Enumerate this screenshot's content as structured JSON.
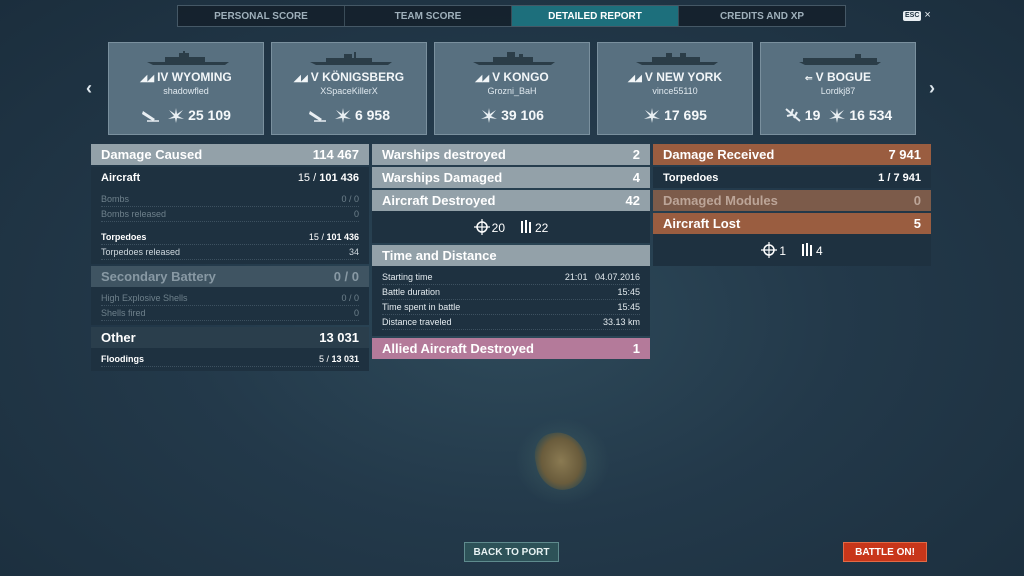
{
  "tabs": [
    {
      "label": "PERSONAL SCORE",
      "active": false
    },
    {
      "label": "TEAM SCORE",
      "active": false
    },
    {
      "label": "DETAILED REPORT",
      "active": true
    },
    {
      "label": "CREDITS AND XP",
      "active": false
    }
  ],
  "esc": {
    "key": "ESC",
    "close": "×"
  },
  "nav": {
    "prev": "‹",
    "next": "›"
  },
  "ships": [
    {
      "tier": "IV",
      "name": "WYOMING",
      "player": "shadowfled",
      "class_icon": "battleship-icon",
      "stat1": null,
      "stat2": "25 109"
    },
    {
      "tier": "V",
      "name": "KÖNIGSBERG",
      "player": "XSpaceKillerX",
      "class_icon": "cruiser-icon",
      "stat1": null,
      "stat2": "6 958"
    },
    {
      "tier": "V",
      "name": "KONGO",
      "player": "Grozni_BaH",
      "class_icon": "battleship-icon",
      "stat1": null,
      "stat2": "39 106"
    },
    {
      "tier": "V",
      "name": "NEW YORK",
      "player": "vince55110",
      "class_icon": "battleship-icon",
      "stat1": null,
      "stat2": "17 695"
    },
    {
      "tier": "V",
      "name": "BOGUE",
      "player": "Lordkj87",
      "class_icon": "carrier-icon",
      "stat1": "19",
      "stat2": "16 534"
    }
  ],
  "left": {
    "damage_caused": {
      "label": "Damage Caused",
      "value": "114 467"
    },
    "aircraft": {
      "label": "Aircraft",
      "value_a": "15",
      "value_b": "101 436"
    },
    "bombs": {
      "label": "Bombs",
      "value": "0 / 0"
    },
    "bombs_released": {
      "label": "Bombs released",
      "value": "0"
    },
    "torpedoes": {
      "label": "Torpedoes",
      "value_a": "15",
      "value_b": "101 436"
    },
    "torpedoes_released": {
      "label": "Torpedoes released",
      "value": "34"
    },
    "secondary": {
      "label": "Secondary Battery",
      "value": "0 / 0"
    },
    "he_shells": {
      "label": "High Explosive Shells",
      "value": "0 / 0"
    },
    "shells_fired": {
      "label": "Shells fired",
      "value": "0"
    },
    "other": {
      "label": "Other",
      "value": "13 031"
    },
    "floodings": {
      "label": "Floodings",
      "value_a": "5",
      "value_b": "13 031"
    }
  },
  "middle": {
    "warships_destroyed": {
      "label": "Warships destroyed",
      "value": "2"
    },
    "warships_damaged": {
      "label": "Warships Damaged",
      "value": "4"
    },
    "aircraft_destroyed": {
      "label": "Aircraft Destroyed",
      "value": "42"
    },
    "icons": {
      "shot_down": "20",
      "squadrons": "22"
    },
    "time_title": "Time and Distance",
    "starting_time": {
      "label": "Starting time",
      "value": "21:01   04.07.2016"
    },
    "battle_duration": {
      "label": "Battle duration",
      "value": "15:45"
    },
    "time_in_battle": {
      "label": "Time spent in battle",
      "value": "15:45"
    },
    "distance": {
      "label": "Distance traveled",
      "value": "33.13 km"
    },
    "allied_aircraft": {
      "label": "Allied Aircraft Destroyed",
      "value": "1"
    }
  },
  "right": {
    "damage_received": {
      "label": "Damage Received",
      "value": "7 941"
    },
    "torpedoes": {
      "label": "Torpedoes",
      "value": "1 / 7 941"
    },
    "damaged_modules": {
      "label": "Damaged Modules",
      "value": "0"
    },
    "aircraft_lost": {
      "label": "Aircraft Lost",
      "value": "5"
    },
    "icons": {
      "shot_down": "1",
      "squadrons": "4"
    }
  },
  "buttons": {
    "back": "BACK TO PORT",
    "battle": "BATTLE ON!"
  }
}
